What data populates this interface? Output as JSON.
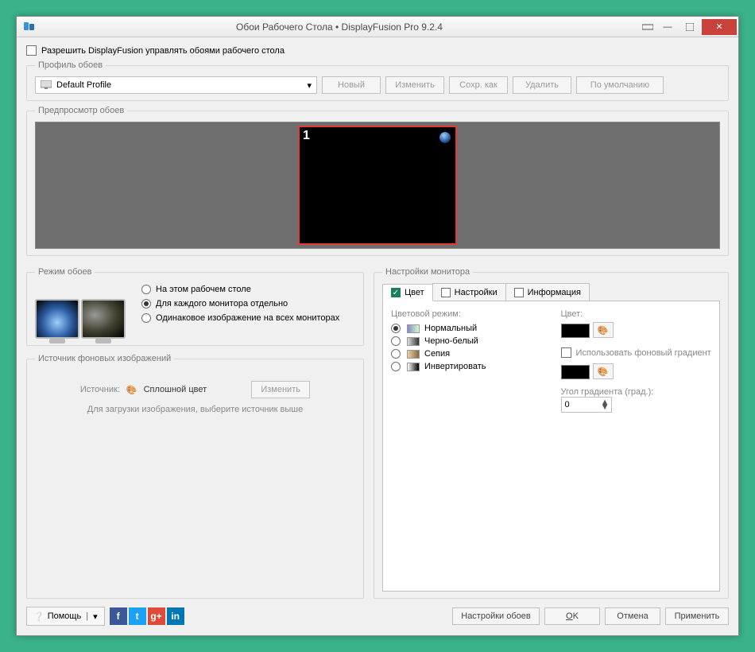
{
  "title": "Обои Рабочего Стола • DisplayFusion Pro 9.2.4",
  "allow_label": "Разрешить DisplayFusion управлять обоями рабочего стола",
  "profile": {
    "legend": "Профиль обоев",
    "selected": "Default Profile",
    "new": "Новый",
    "edit": "Изменить",
    "saveas": "Сохр. как",
    "delete": "Удалить",
    "default": "По умолчанию"
  },
  "preview": {
    "legend": "Предпросмотр обоев",
    "monitor_num": "1"
  },
  "mode": {
    "legend": "Режим обоев",
    "opts": {
      "thisdesktop": "На этом рабочем столе",
      "permonitor": "Для каждого монитора отдельно",
      "same": "Одинаковое изображение на всех мониторах"
    }
  },
  "source": {
    "legend": "Источник фоновых изображений",
    "label": "Источник:",
    "name": "Сплошной цвет",
    "change": "Изменить",
    "hint": "Для загрузки изображения, выберите источник выше"
  },
  "settings": {
    "legend": "Настройки монитора",
    "tabs": {
      "color": "Цвет",
      "settings": "Настройки",
      "info": "Информация"
    },
    "color_mode_label": "Цветовой режим:",
    "color_label": "Цвет:",
    "modes": {
      "normal": "Нормальный",
      "bw": "Черно-белый",
      "sepia": "Сепия",
      "invert": "Инвертировать"
    },
    "use_gradient": "Использовать фоновый градиент",
    "angle_label": "Угол градиента (град.):",
    "angle_value": "0"
  },
  "footer": {
    "help": "Помощь",
    "wall_settings": "Настройки обоев",
    "ok": "OK",
    "cancel": "Отмена",
    "apply": "Применить"
  }
}
